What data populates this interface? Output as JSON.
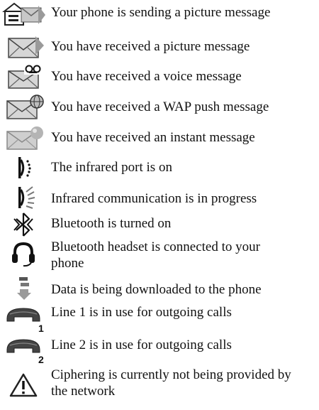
{
  "items": [
    {
      "icon": "sending-picture-message-icon",
      "text": "Your phone is sending a picture message"
    },
    {
      "icon": "picture-message-envelope-icon",
      "text": "You have received a picture message"
    },
    {
      "icon": "voice-message-envelope-icon",
      "text": "You have received a voice message"
    },
    {
      "icon": "wap-push-envelope-icon",
      "text": "You have received a WAP push message"
    },
    {
      "icon": "instant-message-envelope-icon",
      "text": "You have received an instant message"
    },
    {
      "icon": "infrared-port-icon",
      "text": "The infrared port is on"
    },
    {
      "icon": "infrared-communication-icon",
      "text": "Infrared communication is in progress"
    },
    {
      "icon": "bluetooth-icon",
      "text": "Bluetooth is turned on"
    },
    {
      "icon": "bluetooth-headset-icon",
      "text": "Bluetooth headset is connected to your phone"
    },
    {
      "icon": "data-download-icon",
      "text": "Data is being downloaded to the phone"
    },
    {
      "icon": "line-1-handset-icon",
      "text": "Line 1 is in use for outgoing calls"
    },
    {
      "icon": "line-2-handset-icon",
      "text": "Line 2 is in use for outgoing calls"
    },
    {
      "icon": "ciphering-warning-icon",
      "text": "Ciphering is currently not being provided by the network"
    }
  ],
  "line_labels": [
    "1",
    "2"
  ]
}
